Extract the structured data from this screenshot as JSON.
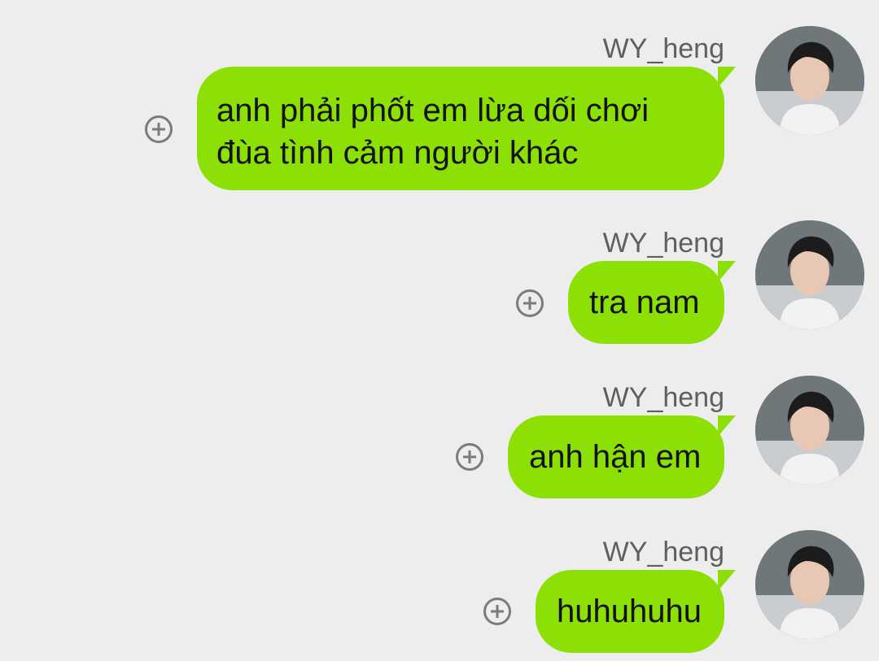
{
  "messages": [
    {
      "sender": "WY_heng",
      "text": "anh phải phốt em lừa dối chơi đùa tình cảm người khác",
      "icons": [
        "add-circle-icon",
        "avatar-image"
      ]
    },
    {
      "sender": "WY_heng",
      "text": "tra nam",
      "icons": [
        "add-circle-icon",
        "avatar-image"
      ]
    },
    {
      "sender": "WY_heng",
      "text": "anh hận em",
      "icons": [
        "add-circle-icon",
        "avatar-image"
      ]
    },
    {
      "sender": "WY_heng",
      "text": "huhuhuhu",
      "icons": [
        "add-circle-icon",
        "avatar-image"
      ]
    }
  ],
  "colors": {
    "background": "#ededed",
    "bubble": "#8de005",
    "sender_text": "#5f5f5f",
    "icon": "#7b7b7b"
  }
}
